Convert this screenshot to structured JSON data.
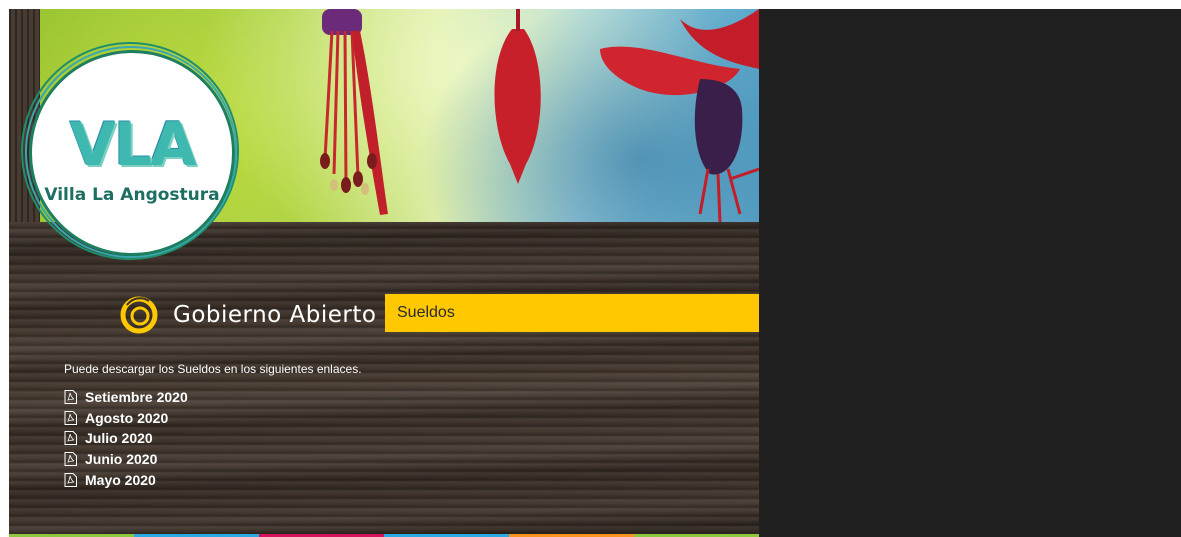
{
  "header": {
    "logo_mark": "VLA",
    "logo_text": "Villa La Angostura"
  },
  "section": {
    "title": "Gobierno Abierto",
    "bar_label": "Sueldos"
  },
  "content": {
    "intro": "Puede descargar los Sueldos en los siguientes enlaces.",
    "links": [
      {
        "label": "Setiembre 2020"
      },
      {
        "label": "Agosto 2020"
      },
      {
        "label": "Julio 2020"
      },
      {
        "label": "Junio 2020"
      },
      {
        "label": "Mayo 2020"
      }
    ]
  },
  "colors": {
    "accent": "#ffc800",
    "wood": "#3b3028",
    "side_panel": "#202020",
    "footer_stripes": [
      "#8dc63f",
      "#29abe2",
      "#d4145a",
      "#29abe2",
      "#f7931e",
      "#8dc63f"
    ]
  },
  "icons": {
    "gobierno": "ring-logo-icon",
    "link": "pdf-file-icon"
  }
}
